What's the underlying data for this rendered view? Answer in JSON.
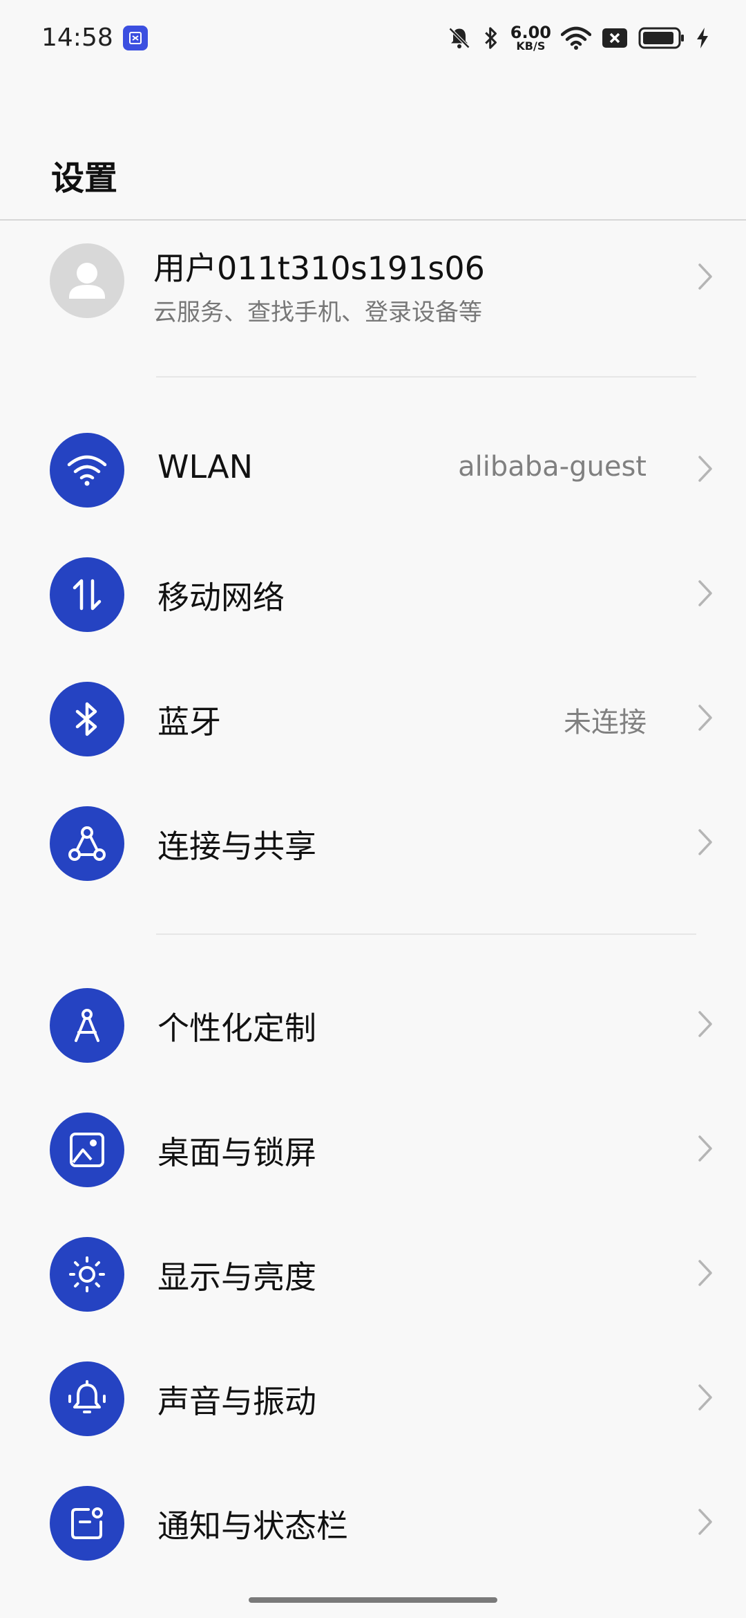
{
  "status_bar": {
    "time": "14:58",
    "net_speed_value": "6.00",
    "net_speed_unit": "KB/S",
    "icons": [
      "mute-bell-icon",
      "bluetooth-icon",
      "wifi-icon",
      "sim-off-icon",
      "battery-icon",
      "charging-icon"
    ]
  },
  "header": {
    "title": "设置"
  },
  "account": {
    "name": "用户011t310s191s06",
    "subtitle": "云服务、查找手机、登录设备等"
  },
  "settings": [
    {
      "label": "WLAN",
      "value": "alibaba-guest",
      "icon": "wifi-icon"
    },
    {
      "label": "移动网络",
      "value": "",
      "icon": "mobile-data-icon"
    },
    {
      "label": "蓝牙",
      "value": "未连接",
      "icon": "bluetooth-icon"
    },
    {
      "label": "连接与共享",
      "value": "",
      "icon": "share-icon"
    },
    {
      "label": "个性化定制",
      "value": "",
      "icon": "compass-icon"
    },
    {
      "label": "桌面与锁屏",
      "value": "",
      "icon": "wallpaper-icon"
    },
    {
      "label": "显示与亮度",
      "value": "",
      "icon": "brightness-icon"
    },
    {
      "label": "声音与振动",
      "value": "",
      "icon": "bell-vibrate-icon"
    },
    {
      "label": "通知与状态栏",
      "value": "",
      "icon": "notification-icon"
    }
  ],
  "colors": {
    "accent": "#2543c2",
    "background": "#f8f8f8"
  }
}
